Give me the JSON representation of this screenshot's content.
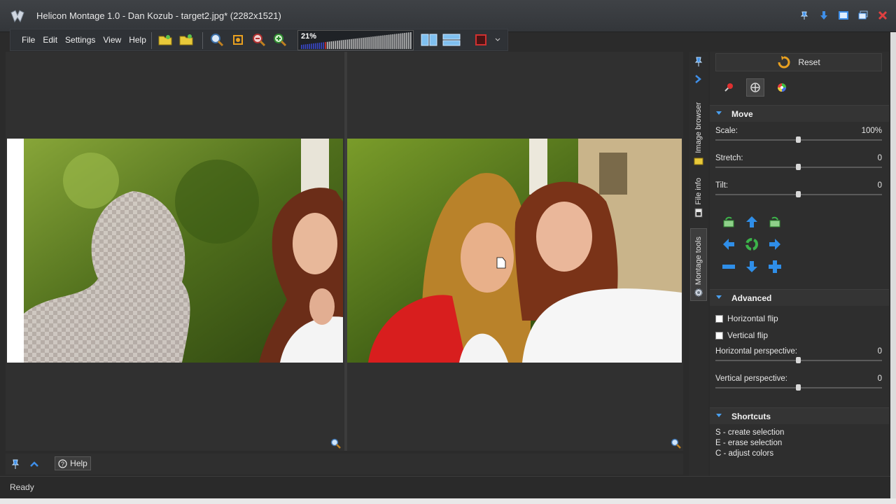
{
  "window": {
    "title": "Helicon Montage 1.0 - Dan Kozub - target2.jpg* (2282x1521)",
    "buttons": [
      "pin-icon",
      "download-icon",
      "restore-icon",
      "maximize-icon",
      "close-icon"
    ]
  },
  "menu": {
    "items": [
      "File",
      "Edit",
      "Settings",
      "View",
      "Help"
    ]
  },
  "toolbar": {
    "zoom_percent": "21%",
    "zoom_level": 0.21
  },
  "side_tabs": [
    {
      "label": "Image browser"
    },
    {
      "label": "File info"
    },
    {
      "label": "Montage tools"
    }
  ],
  "panel": {
    "reset_label": "Reset",
    "move": {
      "title": "Move",
      "scale": {
        "label": "Scale:",
        "value": "100%"
      },
      "stretch": {
        "label": "Stretch:",
        "value": "0"
      },
      "tilt": {
        "label": "Tilt:",
        "value": "0"
      }
    },
    "advanced": {
      "title": "Advanced",
      "hflip": "Horizontal flip",
      "vflip": "Vertical flip",
      "hpersp": {
        "label": "Horizontal perspective:",
        "value": "0"
      },
      "vpersp": {
        "label": "Vertical perspective:",
        "value": "0"
      }
    },
    "shortcuts": {
      "title": "Shortcuts",
      "lines": [
        "S - create selection",
        "E - erase selection",
        "C - adjust colors"
      ]
    }
  },
  "bottom": {
    "help_label": "Help"
  },
  "status": {
    "text": "Ready"
  },
  "colors": {
    "accent": "#4aa0f0",
    "close_red": "#e04040",
    "arrow_blue": "#2f8ee8",
    "arrow_green": "#3cb34a"
  }
}
